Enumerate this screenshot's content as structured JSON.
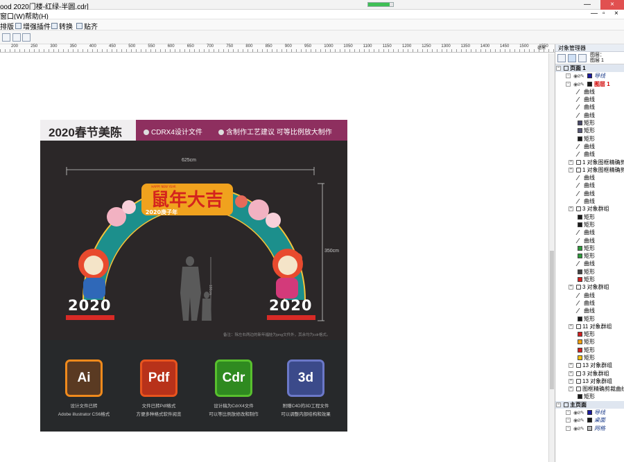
{
  "window": {
    "title": "ood 2020门楼-红绿-半圆.cdr]",
    "minimize": "—",
    "close": "×",
    "progress": 0.85
  },
  "menu": {
    "items": [
      "窗口(W)",
      "帮助(H)"
    ],
    "controls": [
      "—",
      "▫",
      "×"
    ]
  },
  "toolbar": {
    "items": [
      "排版",
      "增强插件",
      "转换",
      "贴齐"
    ]
  },
  "ruler": {
    "ticks": [
      "200",
      "250",
      "300",
      "350",
      "400",
      "450",
      "500",
      "550",
      "600",
      "650",
      "700",
      "750",
      "800",
      "850",
      "900",
      "950",
      "1000",
      "1050",
      "1100",
      "1150",
      "1200",
      "1250",
      "1300",
      "1350",
      "1400",
      "1450",
      "1500",
      "1550"
    ],
    "unit": "毫米"
  },
  "artwork": {
    "title": "2020春节美陈",
    "subtitle1": "CDRX4设计文件",
    "subtitle2": "含制作工艺建议  可等比例放大制作",
    "width_label": "625cm",
    "height_label": "350cm",
    "person_label": "180cm",
    "sign_main": "鼠年大吉",
    "sign_year": "2020庚子年",
    "sign_banner": "HAPPY NEW YEAR",
    "year_left": "2020",
    "year_right": "2020",
    "note": "备注：除左右两边的新年福娃为png文件外，其余均为cdr格式。",
    "formats": [
      {
        "label": "Ai",
        "desc1": "设计文件已转",
        "desc2": "Adobe illustrator CS6格式",
        "color": "#f08a1c",
        "bg": "#5a3a22"
      },
      {
        "label": "Pdf",
        "desc1": "文件已转Pdf格式",
        "desc2": "方便多种格式软件阅览",
        "color": "#e8541e",
        "bg": "#b8321a"
      },
      {
        "label": "Cdr",
        "desc1": "设计稿为CdrX4文件",
        "desc2": "可以等比例放修改和制作",
        "color": "#58c02e",
        "bg": "#2f8a20"
      },
      {
        "label": "3d",
        "desc1": "附赠C4D的3D工程文件",
        "desc2": "可以调整内部结构和效果",
        "color": "#6b78c8",
        "bg": "#3b4a8a"
      }
    ]
  },
  "object_manager": {
    "title": "对象管理器",
    "header_labels": [
      "图层：",
      "图层 1"
    ],
    "rows": [
      {
        "kind": "page",
        "text": "页面 1",
        "indent": 6
      },
      {
        "kind": "layer",
        "text": "导线",
        "indent": 20,
        "swatch": "#1a1aa0"
      },
      {
        "kind": "layer-red",
        "text": "图层 1",
        "indent": 20,
        "swatch": "#1a1a1a"
      },
      {
        "kind": "curve",
        "text": "曲线",
        "indent": 32
      },
      {
        "kind": "curve",
        "text": "曲线",
        "indent": 32
      },
      {
        "kind": "curve",
        "text": "曲线",
        "indent": 32
      },
      {
        "kind": "curve",
        "text": "曲线",
        "indent": 32
      },
      {
        "kind": "rect",
        "text": "矩形",
        "indent": 32,
        "swatch": "#4a4a6a"
      },
      {
        "kind": "rect",
        "text": "矩形",
        "indent": 32,
        "swatch": "#5a5a7a"
      },
      {
        "kind": "rect",
        "text": "矩形",
        "indent": 32,
        "swatch": "#1a1a1a"
      },
      {
        "kind": "curve",
        "text": "曲线",
        "indent": 32
      },
      {
        "kind": "curve",
        "text": "曲线",
        "indent": 32
      },
      {
        "kind": "group",
        "text": "1 对象图框精确剪",
        "indent": 24
      },
      {
        "kind": "group",
        "text": "1 对象图框精确剪",
        "indent": 24
      },
      {
        "kind": "curve",
        "text": "曲线",
        "indent": 32
      },
      {
        "kind": "curve",
        "text": "曲线",
        "indent": 32
      },
      {
        "kind": "curve",
        "text": "曲线",
        "indent": 32
      },
      {
        "kind": "curve",
        "text": "曲线",
        "indent": 32
      },
      {
        "kind": "group",
        "text": "3 对象群组",
        "indent": 24
      },
      {
        "kind": "rect",
        "text": "矩形",
        "indent": 32,
        "swatch": "#1a1a1a"
      },
      {
        "kind": "rect",
        "text": "矩形",
        "indent": 32,
        "swatch": "#1a1a1a"
      },
      {
        "kind": "curve",
        "text": "曲线",
        "indent": 32
      },
      {
        "kind": "curve",
        "text": "曲线",
        "indent": 32
      },
      {
        "kind": "rect",
        "text": "矩形",
        "indent": 32,
        "swatch": "#2e9a3a"
      },
      {
        "kind": "rect",
        "text": "矩形",
        "indent": 32,
        "swatch": "#2e9a3a"
      },
      {
        "kind": "curve",
        "text": "曲线",
        "indent": 32
      },
      {
        "kind": "rect",
        "text": "矩形",
        "indent": 32,
        "swatch": "#444444"
      },
      {
        "kind": "rect",
        "text": "矩形",
        "indent": 32,
        "swatch": "#d02020"
      },
      {
        "kind": "group",
        "text": "3 对象群组",
        "indent": 24
      },
      {
        "kind": "curve",
        "text": "曲线",
        "indent": 32
      },
      {
        "kind": "curve",
        "text": "曲线",
        "indent": 32
      },
      {
        "kind": "curve",
        "text": "曲线",
        "indent": 32
      },
      {
        "kind": "rect",
        "text": "矩形",
        "indent": 32,
        "swatch": "#1a1a1a"
      },
      {
        "kind": "group",
        "text": "11 对象群组",
        "indent": 24
      },
      {
        "kind": "rect",
        "text": "矩形",
        "indent": 32,
        "swatch": "#d02020"
      },
      {
        "kind": "rect",
        "text": "矩形",
        "indent": 32,
        "swatch": "#f0a010"
      },
      {
        "kind": "rect",
        "text": "矩形",
        "indent": 32,
        "swatch": "#d02020"
      },
      {
        "kind": "rect",
        "text": "矩形",
        "indent": 32,
        "swatch": "#f0c010"
      },
      {
        "kind": "group",
        "text": "13 对象群组",
        "indent": 24
      },
      {
        "kind": "group",
        "text": "3 对象群组",
        "indent": 24
      },
      {
        "kind": "group",
        "text": "13 对象群组",
        "indent": 24
      },
      {
        "kind": "group",
        "text": "图框精确剪裁曲线",
        "indent": 24
      },
      {
        "kind": "rect",
        "text": "矩形",
        "indent": 32,
        "swatch": "#1a1a1a"
      },
      {
        "kind": "page",
        "text": "主页面",
        "indent": 6
      },
      {
        "kind": "layer",
        "text": "导线",
        "indent": 20,
        "swatch": "#1a1aa0"
      },
      {
        "kind": "layer",
        "text": "桌面",
        "indent": 20,
        "swatch": "#1a1a1a"
      },
      {
        "kind": "layer",
        "text": "网格",
        "indent": 20,
        "swatch": "#bbbbbb"
      }
    ]
  }
}
